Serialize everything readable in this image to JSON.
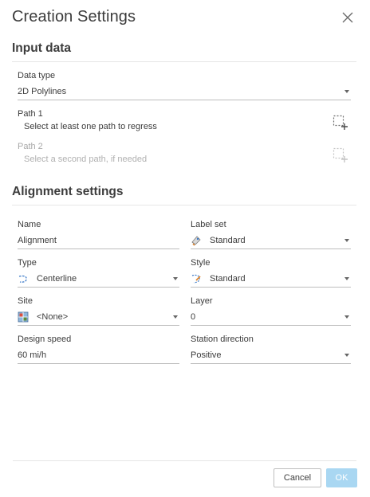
{
  "dialog": {
    "title": "Creation Settings"
  },
  "input_data": {
    "heading": "Input data",
    "data_type": {
      "label": "Data type",
      "value": "2D Polylines"
    },
    "path1": {
      "label": "Path 1",
      "hint": "Select at least one path to regress"
    },
    "path2": {
      "label": "Path 2",
      "hint": "Select a second path, if needed"
    }
  },
  "alignment": {
    "heading": "Alignment settings",
    "name": {
      "label": "Name",
      "value": "Alignment"
    },
    "label_set": {
      "label": "Label set",
      "value": "Standard",
      "icon": "label-set-icon"
    },
    "type": {
      "label": "Type",
      "value": "Centerline",
      "icon": "centerline-icon"
    },
    "style": {
      "label": "Style",
      "value": "Standard",
      "icon": "style-icon"
    },
    "site": {
      "label": "Site",
      "value": "<None>",
      "icon": "site-icon"
    },
    "layer": {
      "label": "Layer",
      "value": "0"
    },
    "design_speed": {
      "label": "Design speed",
      "value": "60 mi/h"
    },
    "station_direction": {
      "label": "Station direction",
      "value": "Positive"
    }
  },
  "footer": {
    "cancel": "Cancel",
    "ok": "OK"
  },
  "colors": {
    "ok_button_bg": "#a9d7f2",
    "text": "#3c3c3c",
    "disabled_text": "#a8a8a8"
  }
}
